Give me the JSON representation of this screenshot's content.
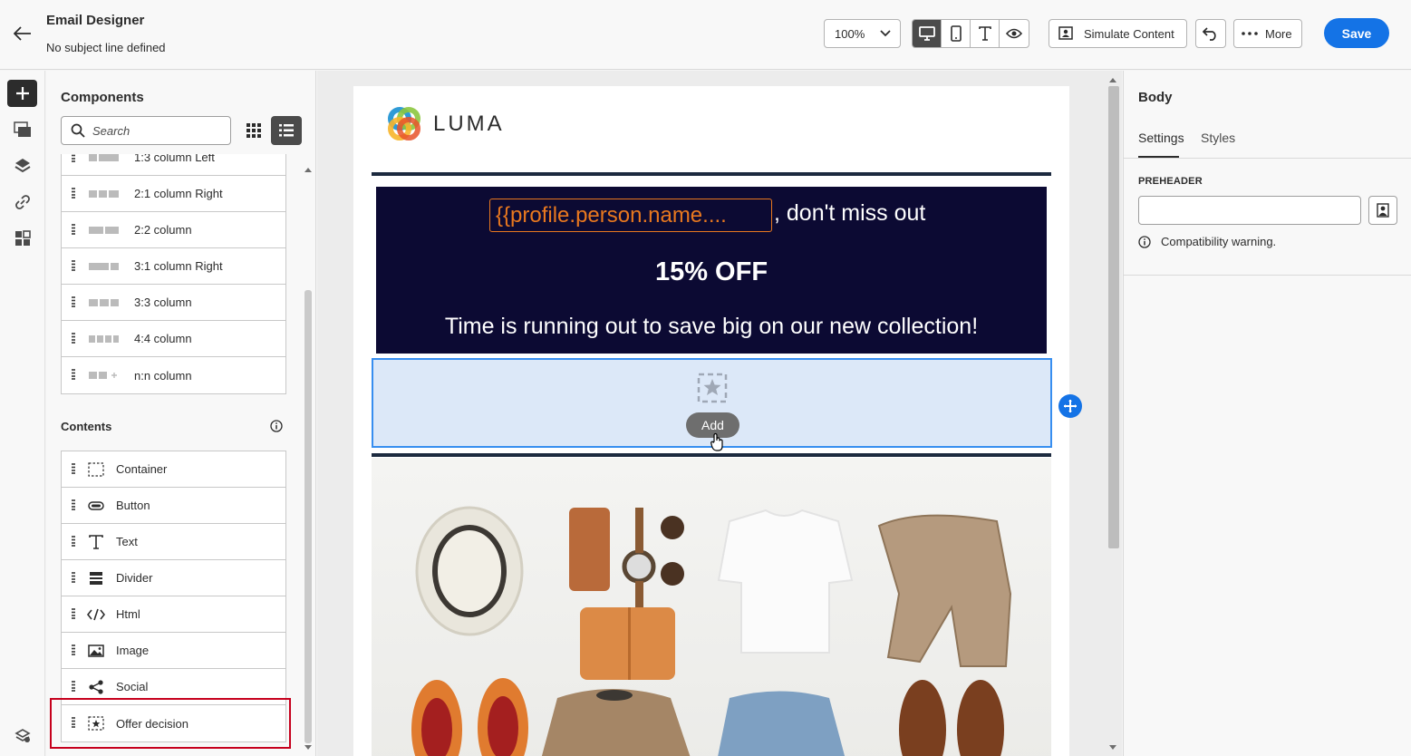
{
  "header": {
    "title": "Email Designer",
    "subtitle": "No subject line defined",
    "zoom": "100%",
    "simulate_label": "Simulate Content",
    "more_label": "More",
    "save_label": "Save"
  },
  "components": {
    "title": "Components",
    "search_placeholder": "Search",
    "structures": [
      {
        "label": "1:3 column Left"
      },
      {
        "label": "2:1 column Right"
      },
      {
        "label": "2:2 column"
      },
      {
        "label": "3:1 column Right"
      },
      {
        "label": "3:3 column"
      },
      {
        "label": "4:4 column"
      },
      {
        "label": "n:n column"
      }
    ],
    "contents_title": "Contents",
    "contents": [
      {
        "label": "Container",
        "icon": "container-icon"
      },
      {
        "label": "Button",
        "icon": "button-icon"
      },
      {
        "label": "Text",
        "icon": "text-icon"
      },
      {
        "label": "Divider",
        "icon": "divider-icon"
      },
      {
        "label": "Html",
        "icon": "html-icon"
      },
      {
        "label": "Image",
        "icon": "image-icon"
      },
      {
        "label": "Social",
        "icon": "social-icon"
      },
      {
        "label": "Offer decision",
        "icon": "offer-decision-icon"
      }
    ]
  },
  "email": {
    "logo_text": "LUMA",
    "token": "{{profile.person.name....",
    "headline_suffix": ", don't miss out",
    "offer": "15% OFF",
    "tagline": "Time is running out to save big on our new collection!",
    "add_label": "Add"
  },
  "right_panel": {
    "title": "Body",
    "tabs": [
      "Settings",
      "Styles"
    ],
    "preheader_label": "PREHEADER",
    "preheader_value": "",
    "warning": "Compatibility warning."
  },
  "colors": {
    "accent": "#1473e6",
    "banner": "#0c0a33",
    "token": "#e8781f",
    "highlight": "#c6001d",
    "dropzone": "#dce8f8"
  }
}
